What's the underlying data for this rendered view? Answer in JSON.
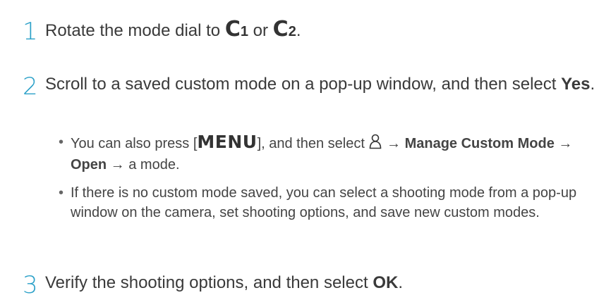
{
  "steps": [
    {
      "number": "1",
      "prefix": "Rotate the mode dial to ",
      "mode1": "C",
      "mode1_sub": "1",
      "or": " or ",
      "mode2": "C",
      "mode2_sub": "2",
      "suffix": "."
    },
    {
      "number": "2",
      "text": "Scroll to a saved custom mode on a pop-up window, and then select ",
      "bold": "Yes",
      "suffix": "."
    },
    {
      "number": "3",
      "text": "Verify the shooting options, and then select ",
      "bold": "OK",
      "suffix": "."
    }
  ],
  "bullets": [
    {
      "pre": "You can also press [",
      "key": "MENU",
      "mid": "], and then select ",
      "arrow1": " → ",
      "bold1": "Manage Custom Mode",
      "arrow2": " → ",
      "bold2": "Open",
      "arrow3": " → ",
      "tail": "a mode."
    },
    {
      "text": "If there is no custom mode saved, you can select a shooting mode from a pop-up window on the camera, set shooting options, and save new custom modes."
    }
  ],
  "bullet_glyph": "•",
  "icons": [
    "person-icon"
  ],
  "colors": {
    "step_number": "#2aa0c8",
    "text": "#3a3a3a"
  }
}
